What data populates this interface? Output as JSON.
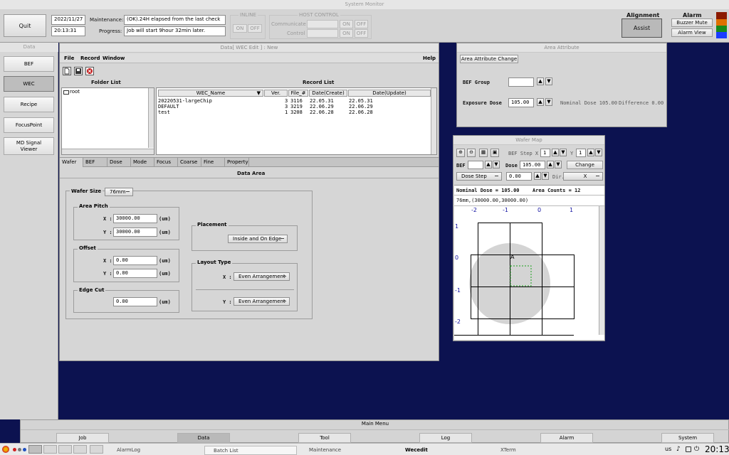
{
  "system_title": "System Monitor",
  "top": {
    "quit": "Quit",
    "date": "2022/11/27",
    "time": "20:13:31",
    "maintenance_label": "Maintenance:",
    "maintenance_value": "(OK).24H elapsed from the last check",
    "progress_label": "Progress:",
    "progress_value": "Job will start 9hour 32min later.",
    "inline_title": "INLINE",
    "on": "ON",
    "off": "OFF",
    "host_title": "HOST CONTROL",
    "communicate": "Communicate",
    "control": "Control",
    "alignment_title": "Alignment",
    "assist": "Assist",
    "alarm_title": "Alarm",
    "buzzer_mute": "Buzzer Mute",
    "alarm_view": "Alarm View",
    "alarm_colors": [
      "#8b1a00",
      "#e07000",
      "#1a8a1a",
      "#1a3cff"
    ]
  },
  "left_nav": {
    "title": "Data",
    "items": [
      "BEF",
      "WEC",
      "Recipe",
      "FocusPoint",
      "MD Signal\nViewer"
    ]
  },
  "wec": {
    "title": "Data[ WEC Edit ] : New",
    "menu": [
      "File",
      "Record",
      "Window"
    ],
    "help": "Help",
    "folder_list_title": "Folder List",
    "folder_root": "root",
    "record_list_title": "Record List",
    "columns": [
      "WEC_Name",
      "Ver.",
      "File_#",
      "Date(Create)",
      "Date(Update)"
    ],
    "rows": [
      [
        "20220531-largeChip",
        "3",
        "3116",
        "22.05.31",
        "22.05.31"
      ],
      [
        "DEFAULT",
        "3",
        "3219",
        "22.06.29",
        "22.06.29"
      ],
      [
        "test",
        "1",
        "3208",
        "22.06.28",
        "22.06.28"
      ]
    ],
    "tabs": [
      "Wafer",
      "BEF",
      "Dose",
      "Mode",
      "Focus",
      "Coarse",
      "Fine",
      "Property"
    ],
    "data_area_title": "Data Area",
    "wafer_size_label": "Wafer Size",
    "wafer_size_value": "76mm",
    "area_pitch_title": "Area Pitch",
    "x_label": "X :",
    "y_label": "Y :",
    "pitch_x": "30000.00",
    "pitch_y": "30000.00",
    "unit": "(um)",
    "offset_title": "Offset",
    "offset_x": "0.00",
    "offset_y": "0.00",
    "edge_cut_title": "Edge Cut",
    "edge_cut": "0.00",
    "placement_title": "Placement",
    "placement_value": "Inside and On Edge",
    "layout_title": "Layout Type",
    "layout_x": "Even Arrangement",
    "layout_y": "Even Arrangement"
  },
  "area_attr": {
    "title": "Area Attribute",
    "change_btn": "Area Attribute Change",
    "bef_group_label": "BEF Group",
    "bef_group_value": "",
    "exposure_label": "Exposure Dose",
    "exposure_value": "105.00",
    "nominal": "Nominal Dose 105.00",
    "difference": "Difference 0.00"
  },
  "wafer_map": {
    "title": "Wafer Map",
    "bef_step_label": "BEF Step X",
    "bef_step_x": "1",
    "y_label": "Y",
    "bef_step_y": "1",
    "bef_label": "BEF",
    "bef_value": "",
    "dose_label": "Dose",
    "dose_value": "105.00",
    "change": "Change",
    "dose_step": "Dose Step",
    "dose_step_value": "0.00",
    "dir_label": "Dir.",
    "dir_value": "X",
    "nominal": "Nominal Dose = 105.00",
    "area_counts": "Area Counts = 12",
    "info": "76mm,(30000.00,30000.00)",
    "x_ticks": [
      "-2",
      "-1",
      "0",
      "1"
    ],
    "y_ticks": [
      "1",
      "0",
      "-1",
      "-2"
    ],
    "cell_label": "A"
  },
  "main_menu": {
    "title": "Main Menu",
    "items": [
      "Job",
      "Data",
      "Tool",
      "Log",
      "Alarm",
      "System"
    ],
    "active": "Data"
  },
  "taskbar": {
    "tasks": [
      "AlarmLog",
      "Batch List",
      "Maintenance",
      "Wecedit",
      "XTerm"
    ],
    "layout": "us",
    "clock": "20:13"
  }
}
